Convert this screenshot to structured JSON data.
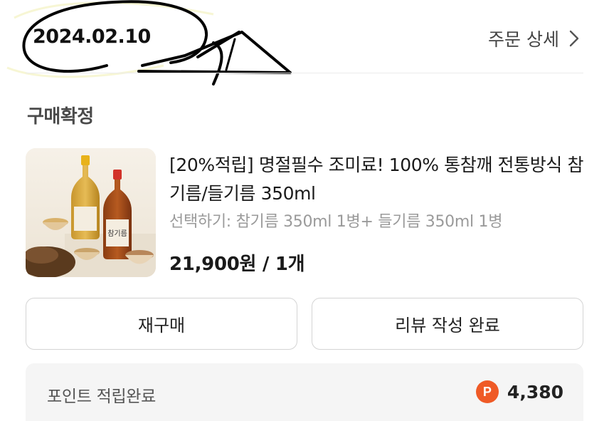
{
  "header": {
    "order_date": "2024.02.10",
    "order_detail_label": "주문 상세"
  },
  "order": {
    "status": "구매확정"
  },
  "product": {
    "title": "[20%적립] 명절필수 조미료! 100% 통참깨 전통방식 참기름/들기름 350ml",
    "option": "선택하기: 참기름 350ml 1병+ 들기름 350ml 1병",
    "price_quantity": "21,900원 / 1개",
    "bottle_label": "참기름"
  },
  "actions": {
    "rebuy_label": "재구매",
    "review_label": "리뷰 작성 완료"
  },
  "points": {
    "label": "포인트 적립완료",
    "badge": "P",
    "value": "4,380"
  },
  "colors": {
    "points_badge": "#ef5a26",
    "status_text": "#4a4a4a",
    "option_text": "#9a9a9a"
  }
}
